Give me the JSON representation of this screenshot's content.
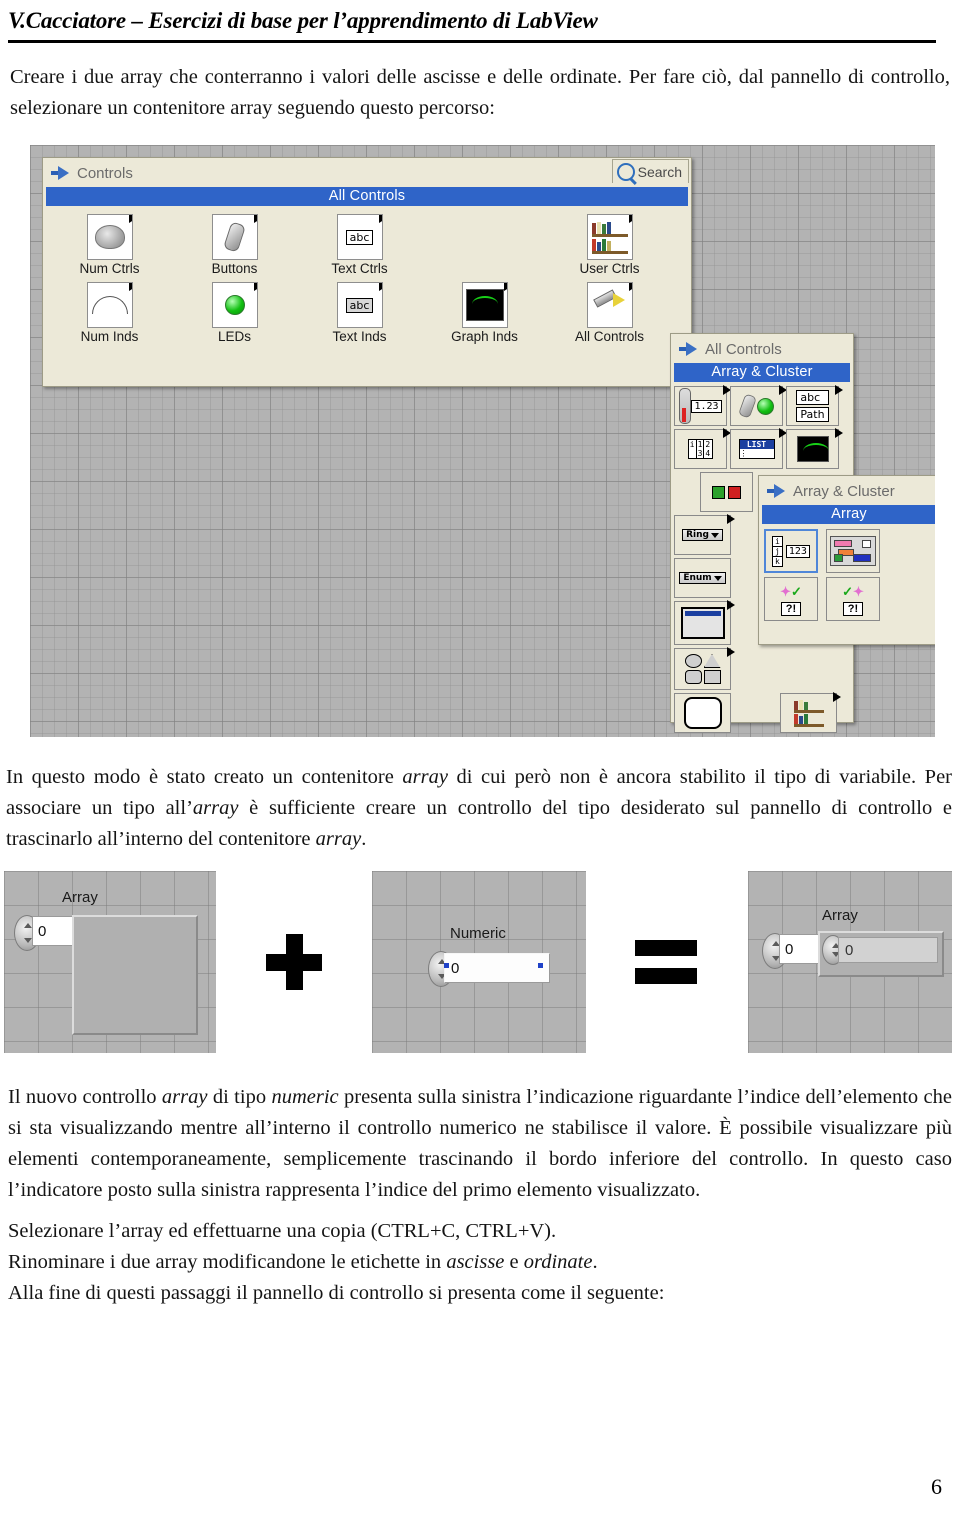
{
  "header": {
    "title": "V.Cacciatore – Esercizi di base per l’apprendimento di LabView"
  },
  "paragraphs": {
    "intro": "Creare i due array che conterranno i valori delle ascisse e delle ordinate. Per fare ciò, dal pannello di controllo, selezionare un contenitore array seguendo questo percorso:",
    "middle_1": "In questo modo è stato creato un contenitore ",
    "middle_2": "array",
    "middle_3": " di cui però non è ancora stabilito il tipo di variabile. Per associare un tipo all’",
    "middle_4": "array",
    "middle_5": " è sufficiente creare un controllo del tipo desiderato sul pannello di controllo e trascinarlo all’interno del contenitore ",
    "middle_6": "array",
    "middle_7": ".",
    "bottom_1": "Il nuovo controllo ",
    "bottom_2": "array",
    "bottom_3": " di tipo ",
    "bottom_4": "numeric",
    "bottom_5": " presenta sulla sinistra l’indicazione riguardante l’indice dell’elemento che si sta visualizzando mentre all’interno il controllo numerico ne stabilisce il valore. È possibile visualizzare più elementi contemporaneamente, semplicemente trascinando il bordo inferiore del controllo. In questo caso l’indicatore posto sulla sinistra rappresenta l’indice del primo elemento visualizzato.",
    "step_1": "Selezionare l’array ed effettuarne una copia (CTRL+C, CTRL+V).",
    "step_2a": "Rinominare i due array modificandone le etichette in ",
    "step_2b": "ascisse",
    "step_2c": " e ",
    "step_2d": "ordinate",
    "step_2e": ".",
    "step_3": "Alla fine di questi passaggi il pannello di controllo si presenta come il seguente:"
  },
  "page_number": "6",
  "palettes": {
    "controls": {
      "title": "Controls",
      "search_label": "Search",
      "banner": "All Controls",
      "items": [
        {
          "label": "Num Ctrls",
          "icon": "knob-icon"
        },
        {
          "label": "Buttons",
          "icon": "toggle-switch-icon"
        },
        {
          "label": "Text Ctrls",
          "icon": "abc-string-icon"
        },
        {
          "label": "",
          "icon": ""
        },
        {
          "label": "User Ctrls",
          "icon": "bookshelf-icon"
        },
        {
          "label": "Num Inds",
          "icon": "gauge-icon"
        },
        {
          "label": "LEDs",
          "icon": "green-led-icon"
        },
        {
          "label": "Text Inds",
          "icon": "abc-indicator-icon"
        },
        {
          "label": "Graph Inds",
          "icon": "waveform-graph-icon"
        },
        {
          "label": "All Controls",
          "icon": "wrench-icon"
        }
      ]
    },
    "all_controls": {
      "title": "All Controls",
      "banner": "Array & Cluster",
      "icons": [
        "numeric-123-icon",
        "boolean-led-icon",
        "string-path-icon",
        "array-cluster-icon",
        "listbox-icon",
        "graph-icon",
        "ring-icon",
        "enum-icon",
        "containers-icon",
        "decorations-icon",
        "dialog-icon",
        "refnum-icon",
        "bookshelf-icon"
      ],
      "labels": {
        "numeric_value": "1.23",
        "abc": "abc",
        "path": "Path",
        "grid_1": "1",
        "grid_2": "2",
        "grid_3": "3",
        "grid_4": "4",
        "list": "LIST",
        "ring": "Ring",
        "enum": "Enum"
      }
    },
    "array_cluster": {
      "title": "Array & Cluster",
      "banner": "Array",
      "icons": [
        "array-icon",
        "cluster-icon",
        "error-in-icon",
        "error-out-icon",
        "refnum-icon"
      ],
      "labels": {
        "index_i": "i",
        "index_j": "j",
        "index_k": "k",
        "value_123": "123",
        "question": "?!"
      }
    }
  },
  "front_panel": {
    "array_empty": {
      "label": "Array",
      "index_value": "0"
    },
    "operator_plus": "+",
    "numeric": {
      "label": "Numeric",
      "value": "0"
    },
    "operator_equals": "=",
    "array_filled": {
      "label": "Array",
      "index_value": "0",
      "element_value": "0"
    }
  },
  "colors": {
    "palette_bg": "#ece9d8",
    "banner_blue": "#2f64c8",
    "panel_gray": "#b3b3b3",
    "text": "#141414"
  }
}
